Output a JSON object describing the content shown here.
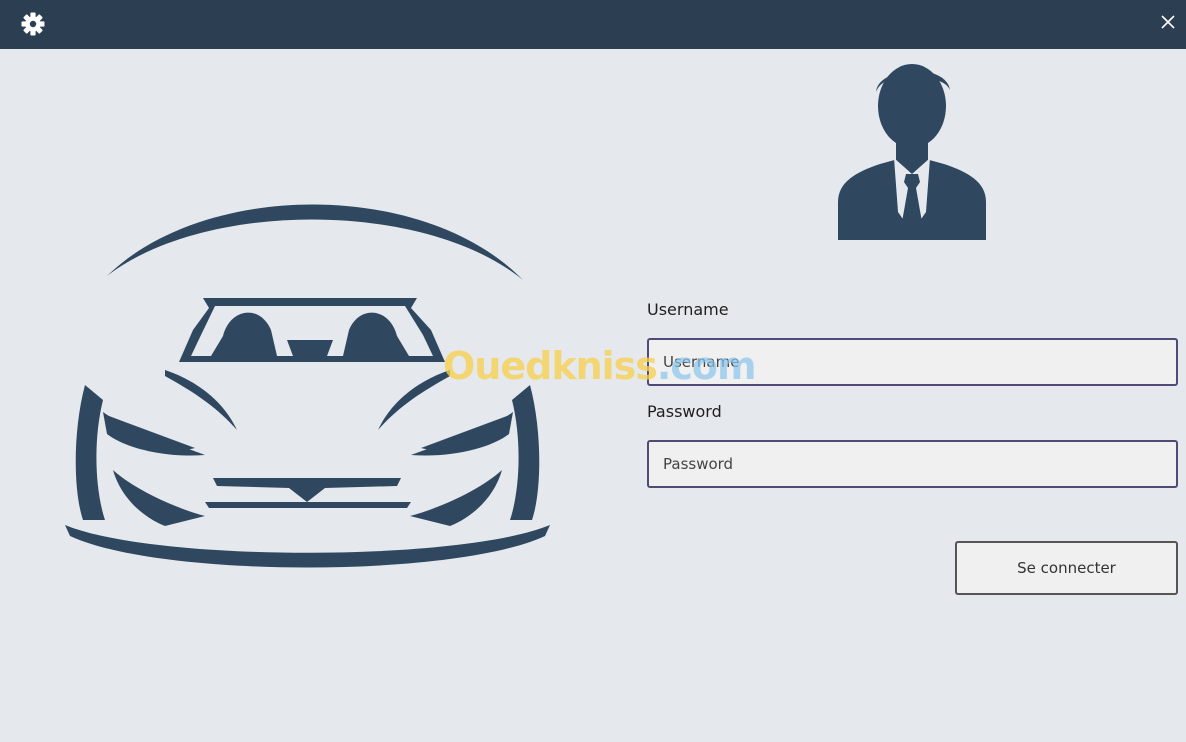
{
  "titlebar": {
    "settings_icon": "gear-icon",
    "close_icon": "close-icon",
    "background": "#2c3e52"
  },
  "illustrations": {
    "car": "car-front-silhouette-icon",
    "user": "businessman-avatar-icon",
    "color": "#2f4860"
  },
  "login": {
    "username_label": "Username",
    "username_placeholder": "Username",
    "username_value": "",
    "password_label": "Password",
    "password_placeholder": "Password",
    "password_value": "",
    "submit_label": "Se connecter"
  },
  "watermark": {
    "part1": "Ouedkniss",
    "part2": ".com"
  }
}
